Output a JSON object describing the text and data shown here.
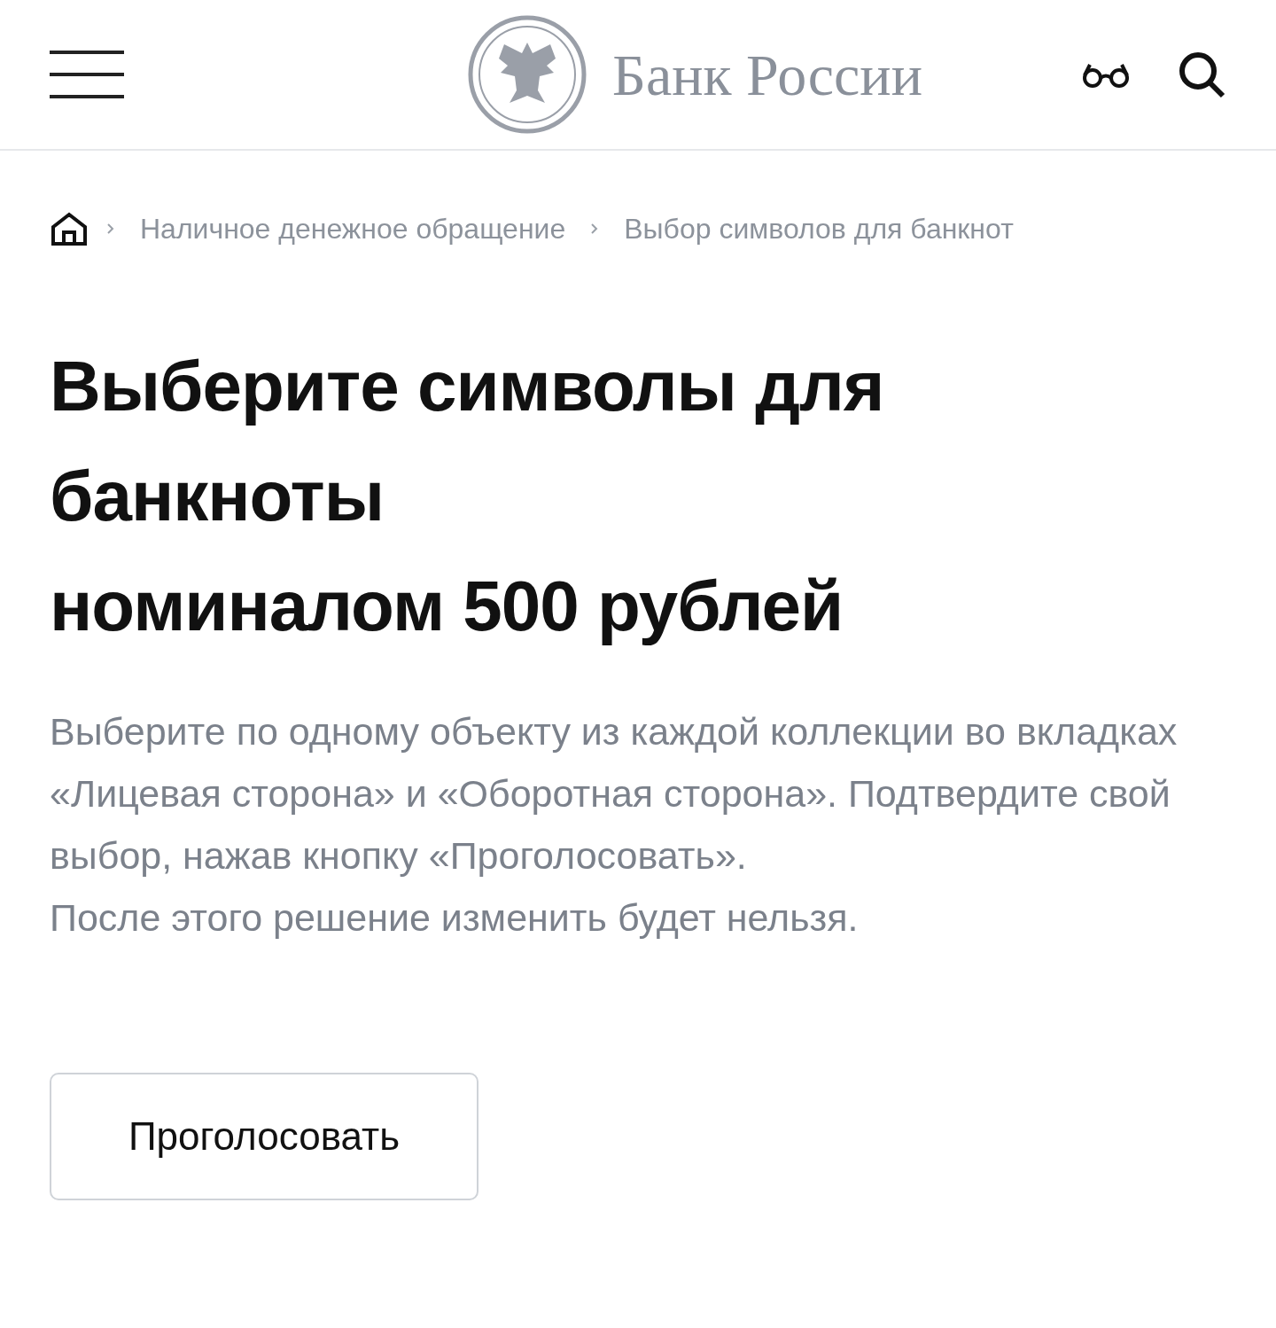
{
  "header": {
    "logo_text": "Банк России"
  },
  "breadcrumbs": [
    "Наличное денежное обращение",
    "Выбор символов для банкнот"
  ],
  "heading_lines": [
    "Выберите символы для",
    "банкноты",
    "номиналом 500 рублей"
  ],
  "paragraphs": [
    "Выберите по одному объекту из каждой коллекции во вкладках «Лицевая сторона» и «Оборотная сторона». Подтвердите свой выбор, нажав кнопку «Проголосовать».",
    "После этого решение изменить будет нельзя."
  ],
  "vote_button": {
    "label": "Проголосовать"
  }
}
